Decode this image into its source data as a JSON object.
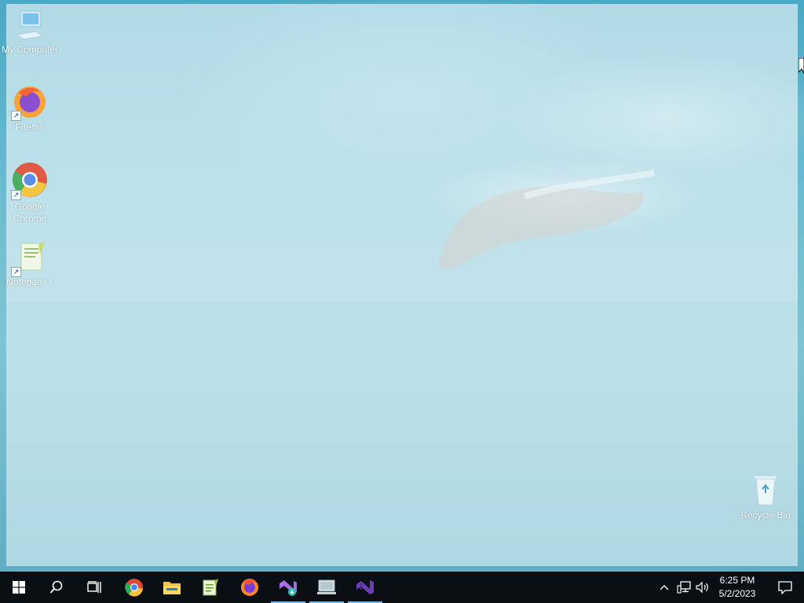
{
  "desktop": {
    "icons": [
      {
        "label": "My Computer",
        "icon": "computer-icon"
      },
      {
        "label": "Firefox",
        "icon": "firefox-icon"
      },
      {
        "label": "Google Chrome",
        "icon": "chrome-icon"
      },
      {
        "label": "Notepad++",
        "icon": "notepad-plus-plus-icon"
      },
      {
        "label": "Recycle Bin",
        "icon": "recycle-bin-icon"
      }
    ]
  },
  "taskbar": {
    "buttons": [
      {
        "icon": "windows-start-icon"
      },
      {
        "icon": "search-icon"
      },
      {
        "icon": "task-view-icon"
      },
      {
        "icon": "chrome-icon"
      },
      {
        "icon": "file-explorer-icon"
      },
      {
        "icon": "notepad-plus-plus-icon"
      },
      {
        "icon": "firefox-icon"
      },
      {
        "icon": "visual-studio-installer-icon"
      },
      {
        "icon": "network-app-icon"
      },
      {
        "icon": "visual-studio-icon"
      }
    ],
    "tray": {
      "icons": [
        "chevron-up-icon",
        "network-icon",
        "volume-icon",
        "notification-icon"
      ],
      "time": "6:25 PM",
      "date": "5/2/2023"
    }
  },
  "colors": {
    "taskbar": "#0a0f14",
    "active_indicator": "#76b9ed",
    "accent": "#2a8fb0"
  }
}
